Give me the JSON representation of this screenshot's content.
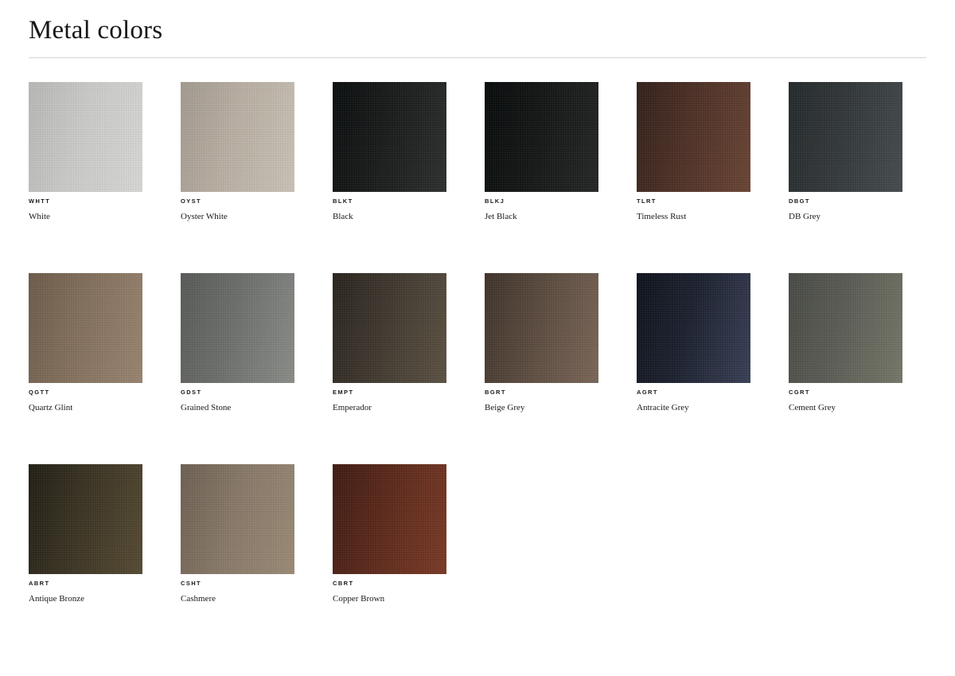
{
  "page": {
    "title": "Metal colors"
  },
  "swatches": [
    {
      "code": "WHTT",
      "name": "White",
      "color": "#c9c9c7",
      "color_light": "#d6d6d4",
      "color_dark": "#b7b7b5"
    },
    {
      "code": "OYST",
      "name": "Oyster White",
      "color": "#b8aea2",
      "color_light": "#c9c1b6",
      "color_dark": "#a39a8f"
    },
    {
      "code": "BLKT",
      "name": "Black",
      "color": "#1a1c1c",
      "color_light": "#2e3030",
      "color_dark": "#0c0f0f"
    },
    {
      "code": "BLKJ",
      "name": "Jet Black",
      "color": "#151717",
      "color_light": "#262828",
      "color_dark": "#090c0c"
    },
    {
      "code": "TLRT",
      "name": "Timeless Rust",
      "color": "#4e3127",
      "color_light": "#6a4535",
      "color_dark": "#33211b"
    },
    {
      "code": "DBGT",
      "name": "DB Grey",
      "color": "#33383a",
      "color_light": "#464c4e",
      "color_dark": "#24292b"
    },
    {
      "code": "QGTT",
      "name": "Quartz Glint",
      "color": "#83705d",
      "color_light": "#978470",
      "color_dark": "#6d5b4a"
    },
    {
      "code": "GDST",
      "name": "Grained Stone",
      "color": "#6d6f6c",
      "color_light": "#8a8c88",
      "color_dark": "#585a58"
    },
    {
      "code": "EMPT",
      "name": "Emperador",
      "color": "#403930",
      "color_light": "#5c5243",
      "color_dark": "#2a241e"
    },
    {
      "code": "BGRT",
      "name": "Beige Grey",
      "color": "#5b4b3f",
      "color_light": "#7a6758",
      "color_dark": "#3f332b"
    },
    {
      "code": "AGRT",
      "name": "Antracite Grey",
      "color": "#1d2230",
      "color_light": "#3a4056",
      "color_dark": "#0f131c"
    },
    {
      "code": "CGRT",
      "name": "Cement Grey",
      "color": "#5b5c55",
      "color_light": "#757768",
      "color_dark": "#484a45"
    },
    {
      "code": "ABRT",
      "name": "Antique Bronze",
      "color": "#3b3424",
      "color_light": "#564b33",
      "color_dark": "#221f15"
    },
    {
      "code": "CSHT",
      "name": "Cashmere",
      "color": "#877868",
      "color_light": "#9a8a76",
      "color_dark": "#6d6052"
    },
    {
      "code": "CBRT",
      "name": "Copper Brown",
      "color": "#5c2a1c",
      "color_light": "#7a3a26",
      "color_dark": "#401c13"
    }
  ]
}
